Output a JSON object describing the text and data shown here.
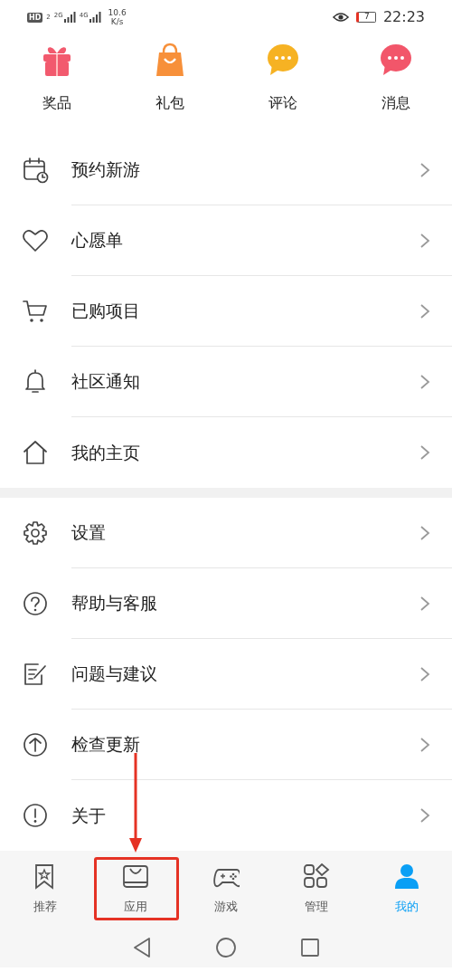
{
  "status_bar": {
    "hd": "HD",
    "sim": "2",
    "networks": [
      "2G",
      "4G"
    ],
    "speed": "10.6",
    "speed_unit": "K/s",
    "battery": "7",
    "time": "22:23"
  },
  "shortcuts": [
    {
      "label": "奖品",
      "color": "#f25a6e"
    },
    {
      "label": "礼包",
      "color": "#f7903a"
    },
    {
      "label": "评论",
      "color": "#f6b223"
    },
    {
      "label": "消息",
      "color": "#f2566a"
    }
  ],
  "menu_groups": [
    {
      "items": [
        {
          "label": "预约新游"
        },
        {
          "label": "心愿单"
        },
        {
          "label": "已购项目"
        },
        {
          "label": "社区通知"
        },
        {
          "label": "我的主页"
        }
      ]
    },
    {
      "items": [
        {
          "label": "设置"
        },
        {
          "label": "帮助与客服"
        },
        {
          "label": "问题与建议"
        },
        {
          "label": "检查更新"
        },
        {
          "label": "关于"
        }
      ]
    }
  ],
  "bottom_nav": [
    {
      "label": "推荐",
      "selected": false,
      "highlighted": false
    },
    {
      "label": "应用",
      "selected": false,
      "highlighted": true
    },
    {
      "label": "游戏",
      "selected": false,
      "highlighted": false
    },
    {
      "label": "管理",
      "selected": false,
      "highlighted": false
    },
    {
      "label": "我的",
      "selected": true,
      "highlighted": false
    }
  ],
  "annotation_arrow": true
}
